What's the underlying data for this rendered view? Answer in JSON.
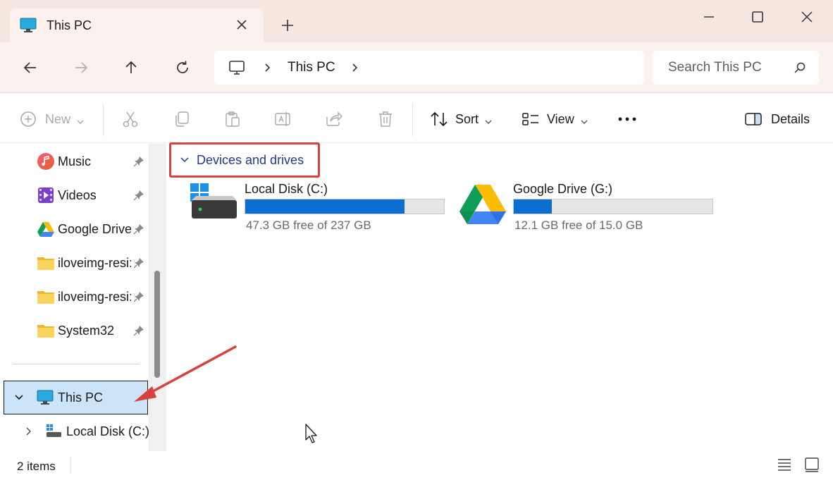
{
  "window": {
    "tab_title": "This PC",
    "tab_icon": "monitor-icon"
  },
  "navigation": {
    "address_crumbs": [
      "This PC"
    ],
    "search_placeholder": "Search This PC"
  },
  "toolbar": {
    "new_label": "New",
    "sort_label": "Sort",
    "view_label": "View",
    "details_label": "Details",
    "disabled_icons": [
      "cut-icon",
      "copy-icon",
      "paste-icon",
      "rename-icon",
      "share-icon",
      "delete-icon"
    ]
  },
  "sidebar": {
    "items": [
      {
        "label": "Music",
        "icon": "music-icon",
        "pinned": true
      },
      {
        "label": "Videos",
        "icon": "videos-icon",
        "pinned": true
      },
      {
        "label": "Google Drive",
        "icon": "google-drive-icon",
        "pinned": true
      },
      {
        "label": "iloveimg-resi:",
        "icon": "folder-icon",
        "pinned": true
      },
      {
        "label": "iloveimg-resi:",
        "icon": "folder-icon",
        "pinned": true
      },
      {
        "label": "System32",
        "icon": "folder-icon",
        "pinned": true
      }
    ],
    "this_pc": {
      "label": "This PC",
      "expanded": true,
      "selected": true
    },
    "local_disk": {
      "label": "Local Disk (C:)",
      "expanded": false
    }
  },
  "content": {
    "group_title": "Devices and drives",
    "drives": [
      {
        "name": "Local Disk (C:)",
        "free_text": "47.3 GB free of 237 GB",
        "used_fraction": 0.8,
        "icon": "hard-drive-icon"
      },
      {
        "name": "Google Drive (G:)",
        "free_text": "12.1 GB free of 15.0 GB",
        "used_fraction": 0.19,
        "icon": "google-drive-icon"
      }
    ]
  },
  "status": {
    "item_count": "2 items"
  },
  "colors": {
    "accent": "#0a6fd1",
    "selection": "#cce4f7",
    "annotation_red": "#d9413d",
    "title_bar": "#f5e6e0"
  }
}
